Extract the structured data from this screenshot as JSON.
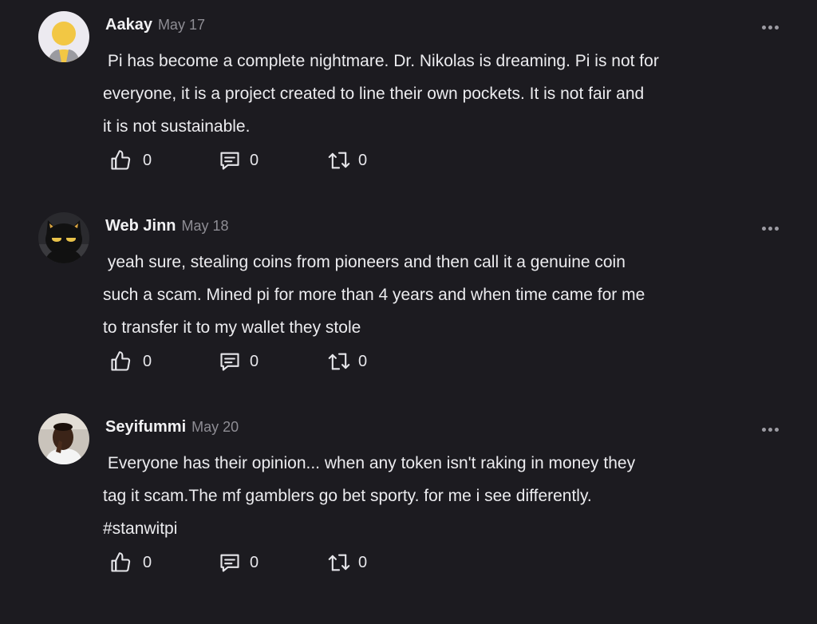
{
  "comments": [
    {
      "author": "Aakay",
      "date": "May 17",
      "text": " Pi has become a complete nightmare. Dr. Nikolas is dreaming. Pi is not for\neveryone, it is a project created to line their own pockets. It is not fair and\nit is not sustainable.",
      "likes": "0",
      "replies": "0",
      "reposts": "0"
    },
    {
      "author": "Web Jinn",
      "date": "May 18",
      "text": " yeah sure, stealing coins from pioneers and then call it a genuine coin\nsuch a scam. Mined pi for more than 4 years and when time came for me\nto transfer it to my wallet they stole",
      "likes": "0",
      "replies": "0",
      "reposts": "0"
    },
    {
      "author": "Seyifummi",
      "date": "May 20",
      "text": " Everyone has their opinion... when any token isn't raking in money they\ntag it scam.The mf gamblers go bet sporty. for me i see differently.\n#stanwitpi",
      "likes": "0",
      "replies": "0",
      "reposts": "0"
    }
  ],
  "icons": {
    "like": "thumbs-up-icon",
    "reply": "comment-icon",
    "repost": "repost-icon",
    "more": "more-options-icon"
  }
}
